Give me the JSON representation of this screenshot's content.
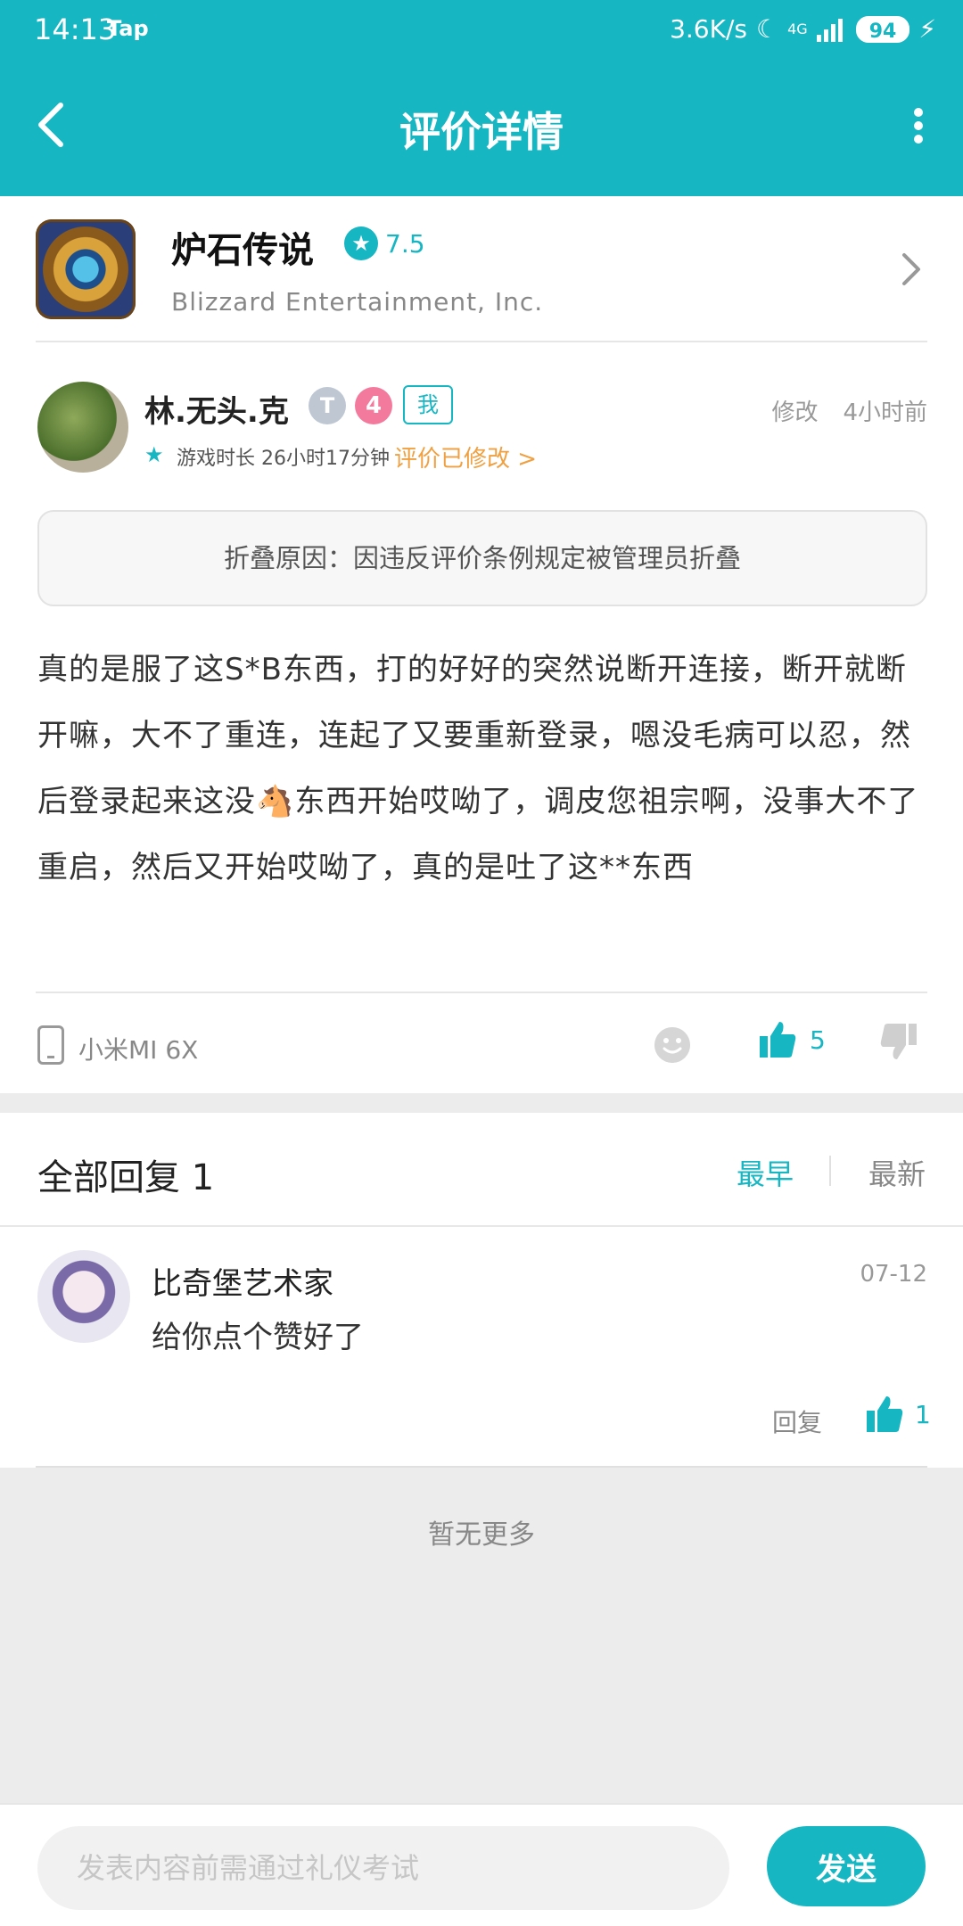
{
  "status_bar": {
    "time": "14:13",
    "app": "Tap",
    "speed": "3.6K/s",
    "network": "4G",
    "battery": "94"
  },
  "nav": {
    "title": "评价详情"
  },
  "game": {
    "name": "炉石传说",
    "score": "7.5",
    "developer": "Blizzard Entertainment, Inc."
  },
  "review": {
    "user": "林.无头.克",
    "badge_t": "T",
    "badge_level": "4",
    "badge_me": "我",
    "edit_label": "修改",
    "time_ago": "4小时前",
    "play_time": "游戏时长 26小时17分钟",
    "edited_link": "评价已修改 >",
    "fold_reason": "折叠原因：因违反评价条例规定被管理员折叠",
    "text": "真的是服了这S*B东西，打的好好的突然说断开连接，断开就断开嘛，大不了重连，连起了又要重新登录，嗯没毛病可以忍，然后登录起来这没🐴东西开始哎呦了，调皮您祖宗啊，没事大不了重启，然后又开始哎呦了，真的是吐了这**东西",
    "device": "小米MI 6X",
    "likes": "5"
  },
  "replies": {
    "title": "全部回复 1",
    "sort_earliest": "最早",
    "sort_newest": "最新",
    "items": [
      {
        "user": "比奇堡艺术家",
        "date": "07-12",
        "text": "给你点个赞好了",
        "reply_label": "回复",
        "likes": "1"
      }
    ]
  },
  "no_more": "暂无更多",
  "input": {
    "placeholder": "发表内容前需通过礼仪考试",
    "send_label": "发送"
  },
  "colors": {
    "accent": "#16b6c3",
    "edited": "#f0a040",
    "badge_pink": "#f37a9c"
  }
}
